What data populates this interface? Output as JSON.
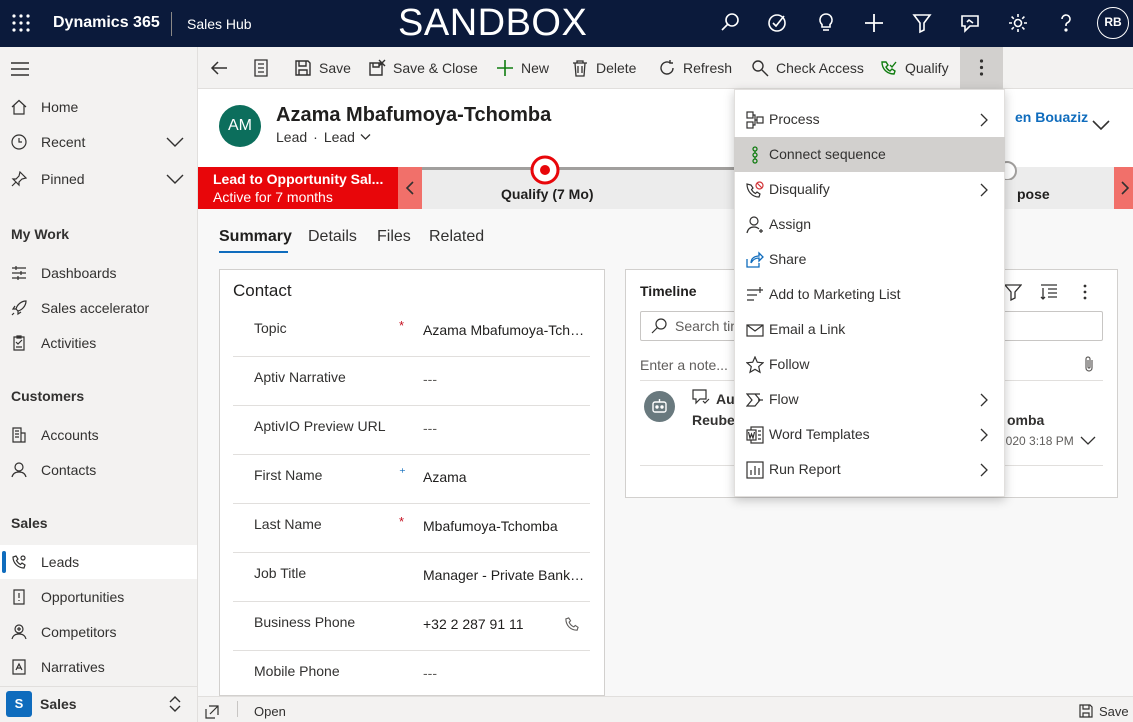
{
  "topbar": {
    "brand": "Dynamics 365",
    "app_name": "Sales Hub",
    "banner": "SANDBOX",
    "user_initials": "RB",
    "icons": [
      "search-icon",
      "task-icon",
      "lightbulb-icon",
      "plus-icon",
      "filter-icon",
      "assistant-icon",
      "gear-icon",
      "help-icon"
    ]
  },
  "sidebar": {
    "items": [
      {
        "label": "Home"
      },
      {
        "label": "Recent"
      },
      {
        "label": "Pinned"
      }
    ],
    "groups": [
      {
        "title": "My Work",
        "items": [
          {
            "label": "Dashboards"
          },
          {
            "label": "Sales accelerator"
          },
          {
            "label": "Activities"
          }
        ]
      },
      {
        "title": "Customers",
        "items": [
          {
            "label": "Accounts"
          },
          {
            "label": "Contacts"
          }
        ]
      },
      {
        "title": "Sales",
        "items": [
          {
            "label": "Leads"
          },
          {
            "label": "Opportunities"
          },
          {
            "label": "Competitors"
          },
          {
            "label": "Narratives"
          }
        ]
      }
    ],
    "area": {
      "badge": "S",
      "label": "Sales"
    }
  },
  "commands": {
    "save": "Save",
    "save_close": "Save & Close",
    "new": "New",
    "delete": "Delete",
    "refresh": "Refresh",
    "check_access": "Check Access",
    "qualify": "Qualify"
  },
  "record": {
    "initials": "AM",
    "name": "Azama Mbafumoya-Tchomba",
    "entity": "Lead",
    "form": "Lead",
    "separator": "·",
    "owner": "en Bouaziz"
  },
  "bpf": {
    "title": "Lead to Opportunity Sal...",
    "subtitle": "Active for 7 months",
    "stage_current": "Qualify  (7 Mo)",
    "stage_next": "pose"
  },
  "tabs": [
    {
      "label": "Summary"
    },
    {
      "label": "Details"
    },
    {
      "label": "Files"
    },
    {
      "label": "Related"
    }
  ],
  "contact": {
    "title": "Contact",
    "fields": [
      {
        "label": "Topic",
        "req": "*",
        "value": "Azama Mbafumoya-Tchomba"
      },
      {
        "label": "Aptiv Narrative",
        "req": "",
        "value": "---"
      },
      {
        "label": "AptivIO Preview URL",
        "req": "",
        "value": "---"
      },
      {
        "label": "First Name",
        "req": "⁺",
        "value": "Azama"
      },
      {
        "label": "Last Name",
        "req": "*",
        "value": "Mbafumoya-Tchomba"
      },
      {
        "label": "Job Title",
        "req": "",
        "value": "Manager - Private Banking"
      },
      {
        "label": "Business Phone",
        "req": "",
        "value": "+32 2 287 91 11"
      },
      {
        "label": "Mobile Phone",
        "req": "",
        "value": "---"
      }
    ]
  },
  "timeline": {
    "title": "Timeline",
    "search_placeholder": "Search tim",
    "note_placeholder": "Enter a note...",
    "entry": {
      "line1": "Au",
      "line2": "Reuben",
      "name": "omba",
      "date": "2020 3:18 PM"
    }
  },
  "menu": {
    "items": [
      {
        "label": "Process",
        "icon": "process-icon",
        "submenu": true
      },
      {
        "label": "Connect sequence",
        "icon": "sequence-icon",
        "submenu": false
      },
      {
        "label": "Disqualify",
        "icon": "disqualify-icon",
        "submenu": true
      },
      {
        "label": "Assign",
        "icon": "assign-icon",
        "submenu": false
      },
      {
        "label": "Share",
        "icon": "share-icon",
        "submenu": false
      },
      {
        "label": "Add to Marketing List",
        "icon": "list-add-icon",
        "submenu": false
      },
      {
        "label": "Email a Link",
        "icon": "email-icon",
        "submenu": false
      },
      {
        "label": "Follow",
        "icon": "star-icon",
        "submenu": false
      },
      {
        "label": "Flow",
        "icon": "flow-icon",
        "submenu": true
      },
      {
        "label": "Word Templates",
        "icon": "word-icon",
        "submenu": true
      },
      {
        "label": "Run Report",
        "icon": "report-icon",
        "submenu": true
      }
    ]
  },
  "statusbar": {
    "open": "Open",
    "save": "Save"
  }
}
